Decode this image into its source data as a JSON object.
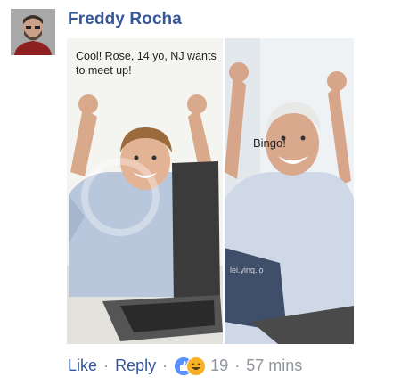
{
  "comment": {
    "author": "Freddy Rocha",
    "meme": {
      "left_caption": "Cool! Rose, 14 yo, NJ wants to meet up!",
      "right_caption": "Bingo!",
      "watermark": "lei.ying.lo"
    },
    "actions": {
      "like": "Like",
      "reply": "Reply",
      "reaction_count": "19",
      "time": "57 mins"
    },
    "reactions": [
      "like-icon",
      "haha-icon"
    ],
    "colors": {
      "link": "#365899",
      "muted": "#90949c",
      "like": "#5890ff",
      "haha": "#f7b125"
    }
  }
}
